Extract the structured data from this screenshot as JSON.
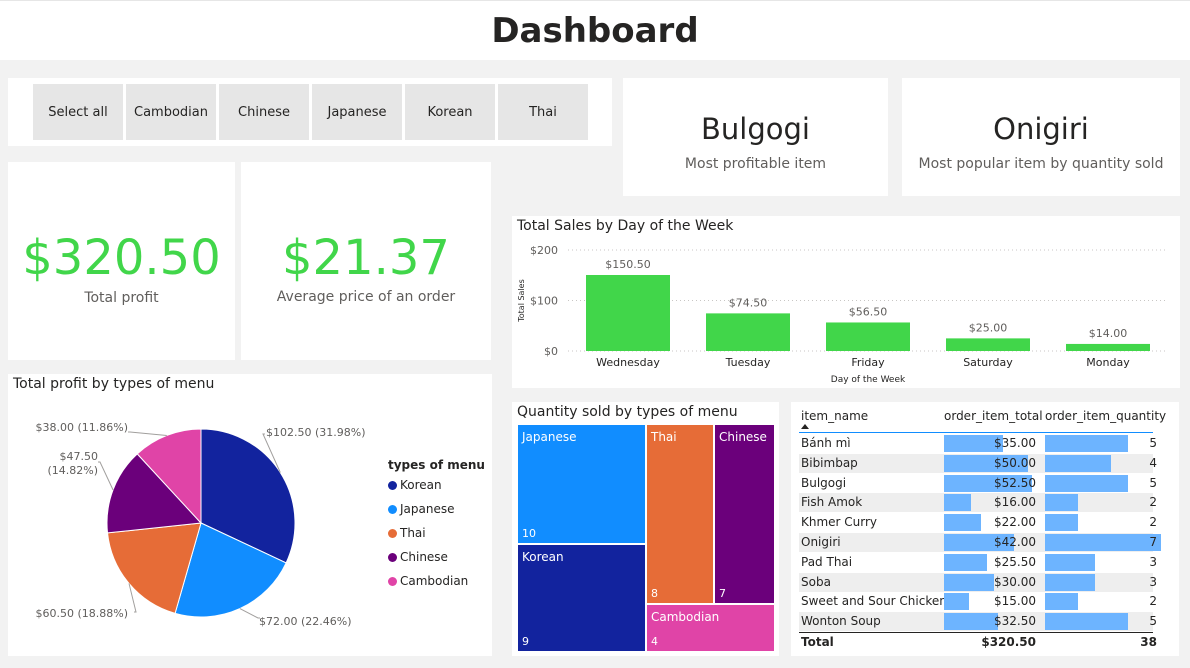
{
  "page": {
    "title": "Dashboard"
  },
  "slicer": {
    "buttons": [
      "Select all",
      "Cambodian",
      "Chinese",
      "Japanese",
      "Korean",
      "Thai"
    ]
  },
  "kpis": {
    "most_profitable": {
      "value": "Bulgogi",
      "label": "Most profitable item"
    },
    "most_popular": {
      "value": "Onigiri",
      "label": "Most popular item by quantity sold"
    },
    "total_profit": {
      "value": "$320.50",
      "label": "Total profit"
    },
    "avg_order": {
      "value": "$21.37",
      "label": "Average price of an order"
    }
  },
  "colors": {
    "accent_green": "#41d64a",
    "korean": "#12239e",
    "japanese": "#118dff",
    "thai": "#e66c37",
    "chinese": "#6b007b",
    "cambodian": "#e044a7",
    "table_bar": "#6db4ff"
  },
  "chart_data": [
    {
      "type": "bar",
      "title": "Total Sales by Day of the Week",
      "xlabel": "Day of the Week",
      "ylabel": "Total Sales",
      "categories": [
        "Wednesday",
        "Tuesday",
        "Friday",
        "Saturday",
        "Monday"
      ],
      "values": [
        150.5,
        74.5,
        56.5,
        25.0,
        14.0
      ],
      "data_labels": [
        "$150.50",
        "$74.50",
        "$56.50",
        "$25.00",
        "$14.00"
      ],
      "yticks": [
        "$200",
        "$100",
        "$0"
      ],
      "ylim": [
        0,
        200
      ],
      "grid": true
    },
    {
      "type": "pie",
      "title": "Total profit by types of menu",
      "legend_title": "types of menu",
      "legend_position": "right",
      "slices": [
        {
          "name": "Korean",
          "value": 102.5,
          "label": "$102.50 (31.98%)"
        },
        {
          "name": "Japanese",
          "value": 72.0,
          "label": "$72.00 (22.46%)"
        },
        {
          "name": "Thai",
          "value": 60.5,
          "label": "$60.50 (18.88%)"
        },
        {
          "name": "Chinese",
          "value": 47.5,
          "label_line1": "$47.50",
          "label_line2": "(14.82%)"
        },
        {
          "name": "Cambodian",
          "value": 38.0,
          "label": "$38.00 (11.86%)"
        }
      ]
    },
    {
      "type": "treemap",
      "title": "Quantity sold by types of menu",
      "items": [
        {
          "name": "Japanese",
          "value": 10
        },
        {
          "name": "Korean",
          "value": 9
        },
        {
          "name": "Thai",
          "value": 8
        },
        {
          "name": "Chinese",
          "value": 7
        },
        {
          "name": "Cambodian",
          "value": 4
        }
      ]
    },
    {
      "type": "table",
      "columns": [
        "item_name",
        "order_item_total",
        "order_item_quantity"
      ],
      "rows": [
        {
          "name": "Bánh mì",
          "total": 35.0,
          "total_label": "$35.00",
          "qty": 5
        },
        {
          "name": "Bibimbap",
          "total": 50.0,
          "total_label": "$50.00",
          "qty": 4
        },
        {
          "name": "Bulgogi",
          "total": 52.5,
          "total_label": "$52.50",
          "qty": 5
        },
        {
          "name": "Fish Amok",
          "total": 16.0,
          "total_label": "$16.00",
          "qty": 2
        },
        {
          "name": "Khmer Curry",
          "total": 22.0,
          "total_label": "$22.00",
          "qty": 2
        },
        {
          "name": "Onigiri",
          "total": 42.0,
          "total_label": "$42.00",
          "qty": 7
        },
        {
          "name": "Pad Thai",
          "total": 25.5,
          "total_label": "$25.50",
          "qty": 3
        },
        {
          "name": "Soba",
          "total": 30.0,
          "total_label": "$30.00",
          "qty": 3
        },
        {
          "name": "Sweet and Sour Chicken",
          "total": 15.0,
          "total_label": "$15.00",
          "qty": 2
        },
        {
          "name": "Wonton Soup",
          "total": 32.5,
          "total_label": "$32.50",
          "qty": 5
        }
      ],
      "total_row": {
        "label": "Total",
        "total": "$320.50",
        "qty": "38"
      }
    }
  ]
}
